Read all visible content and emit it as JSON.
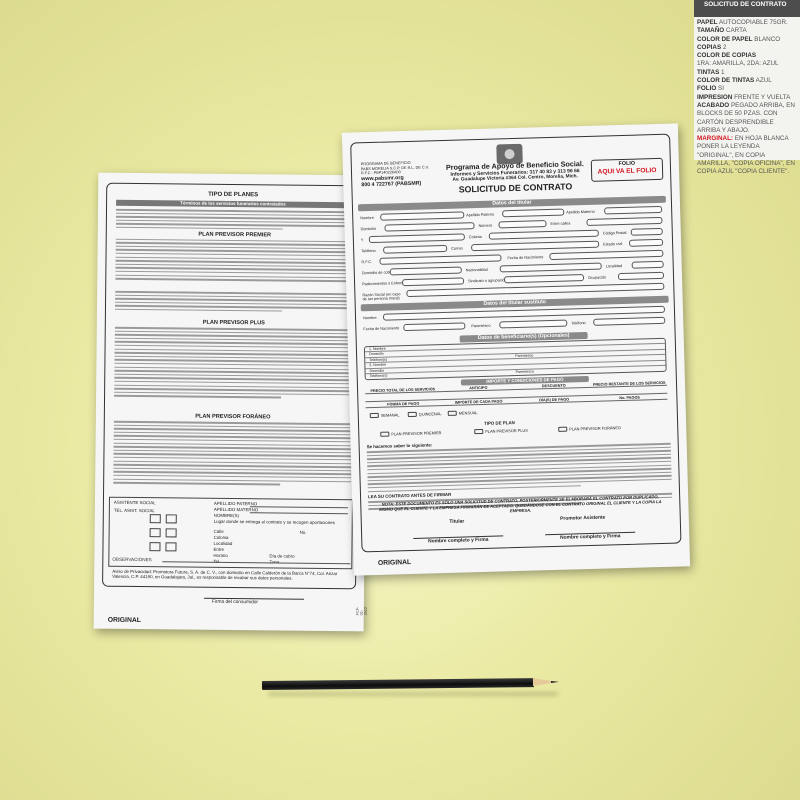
{
  "spec_panel": {
    "title": "SOLICITUD DE CONTRATO",
    "items": [
      {
        "key": "PAPEL",
        "value": "AUTOCOPIABLE 75GR."
      },
      {
        "key": "TAMAÑO",
        "value": "CARTA"
      },
      {
        "key": "COLOR DE PAPEL",
        "value": "BLANCO"
      },
      {
        "key": "COPIAS",
        "value": "2"
      },
      {
        "key": "COLOR DE COPIAS",
        "value": "1RA: AMARILLA, 2DA: AZUL"
      },
      {
        "key": "TINTAS",
        "value": "1"
      },
      {
        "key": "COLOR DE TINTAS",
        "value": "AZUL"
      },
      {
        "key": "FOLIO",
        "value": "SI"
      },
      {
        "key": "IMPRESION",
        "value": "FRENTE Y VUELTA"
      },
      {
        "key": "ACABADO",
        "value": "PEGADO ARRIBA, EN BLOCKS DE 50 PZAS. CON CARTÓN DESPRENDIBLE ARRIBA Y ABAJO."
      },
      {
        "key": "MARGINAL:",
        "value": "EN HOJA BLANCA PONER LA LEYENDA \"ORIGINAL\", EN COPIA AMARILLA, \"COPIA OFICINA\", EN COPIA AZUL \"COPIA CLIENTE\"."
      }
    ]
  },
  "back_sheet": {
    "title": "TIPO DE PLANES",
    "bar": "Términos de los servicios funerarios contratados",
    "sections": [
      "PLAN PREVISOR PREMIER",
      "PLAN PREVISOR PLUS",
      "PLAN PREVISOR FORÁNEO"
    ],
    "form_labels": [
      "ASISTENTE SOCIAL",
      "APELLIDO PATERNO",
      "TEL. ASIST. SOCIAL",
      "APELLIDO MATERNO",
      "NOMBRE(S)",
      "Lugar donde se entrega el contrato y se recogen aportaciones",
      "Calle",
      "Colonia",
      "Localidad",
      "Entre",
      "Horario",
      "Tel",
      "No.",
      "Día de cobro",
      "Zona"
    ],
    "observaciones": "OBSERVACIONES",
    "aviso": "Aviso de Privacidad: Promotora Futura, S. A. de C. V., con domicilio en Calle Calderón de la Barca N°74, Col. Anzar Valencia, C.P. 44190, en Guadalajara, Jal., es responsable de recabar sus datos personales.",
    "firma": "Firma del consumidor",
    "original": "ORIGINAL",
    "side_code": "FCF-01-2022"
  },
  "front_sheet": {
    "header_left": {
      "line1": "PROGRAMA DE BENEFICIO",
      "line2": "PABS MORELIA S.C.P. DE R.L. DE C.V.",
      "line3": "R.F.C.: PBP140226A00",
      "web": "www.pabsmr.org",
      "phone": "800 4 722767 (PABSMR)"
    },
    "org": "Programa de Apoyo de Beneficio Social.",
    "info": "Informes y Servicios Funerarios: 317 40 83 y 313 96 66",
    "address": "Av. Guadalupe Victoria #364 Col. Centro, Morelia, Mich.",
    "form_title": "SOLICITUD DE CONTRATO",
    "folio_label": "FOLIO",
    "folio_value": "AQUI VA EL FOLIO",
    "sec_titular": "Datos del titular",
    "sec_sustituto": "Datos del titular sustituto",
    "sec_beneficiarios": "Datos de beneficiario(s) (Opcionales)",
    "sec_importe": "IMPORTE Y CONDICIONES DE PAGO",
    "labels": {
      "nombre": "Nombre",
      "ap_paterno": "Apellido Paterno",
      "ap_materno": "Apellido Materno",
      "domicilio": "Domicilio",
      "numero": "Número",
      "entre_calles": "Entre calles",
      "y": "Y",
      "colonia": "Colonia",
      "codigo_postal": "Código Postal",
      "telefono": "Teléfono",
      "correo": "Correo",
      "estado_civil": "Estado civil",
      "rfc": "R.F.C.",
      "fecha_nac": "Fecha de Nacimiento",
      "domicilio_cobro": "Domicilio de cobro",
      "nacionalidad": "Nacionalidad",
      "localidad": "Localidad",
      "padecimientos": "Padecimientos o Enfermedades",
      "sindicato": "Sindicato o agrupación",
      "ocupacion": "Ocupación",
      "razon_social": "Razón Social (en caso de ser persona moral)",
      "fecha_nacimiento": "Fecha de Nacimiento",
      "parentesco": "Parentesco",
      "nombre_ben": "1. Nombre",
      "domicilio_ben": "Domicilio",
      "telefono_ben": "Teléfono(s)",
      "nombre_ben2": "2. Nombre",
      "parentesco_ben": "Parentesco"
    },
    "importe_cols": [
      "PRECIO TOTAL DE LOS SERVICIOS",
      "ANTICIPO",
      "DESCUENTO",
      "PRECIO RESTANTE DE LOS SERVICIOS"
    ],
    "pago_cols": [
      "FORMA DE PAGO",
      "IMPORTE DE CADA PAGO",
      "DÍA(S) DE PAGO",
      "No. PAGOS"
    ],
    "forma_pago": [
      "SEMANAL",
      "QUINCENAL",
      "MENSUAL"
    ],
    "tipo_plan": "TIPO DE PLAN",
    "planes": [
      "PLAN PREVISOR PREMIER",
      "PLAN PREVISOR PLUS",
      "PLAN PREVISOR FORÁNEO"
    ],
    "notes_title": "Se hacemos saber lo siguiente:",
    "notes_title2": "LEA SU CONTRATO ANTES DE FIRMAR",
    "bold_note": "NOTA: ESTE DOCUMENTO ES SÓLO UNA SOLICITUD DE CONTRATO, POSTERIORMENTE SE ELABORARÁ EL CONTRATO POR DUPLICADO, MISMO QUE EL CLIENTE Y LA EMPRESA FIRMARÁN DE ACEPTADO, QUEDÁNDOSE CON EL CONTRATO ORIGINAL EL CLIENTE Y LA COPIA LA EMPRESA.",
    "titular": "Titular",
    "promotor": "Promotor Asistente",
    "nombre_firma": "Nombre completo y Firma",
    "original": "ORIGINAL"
  }
}
